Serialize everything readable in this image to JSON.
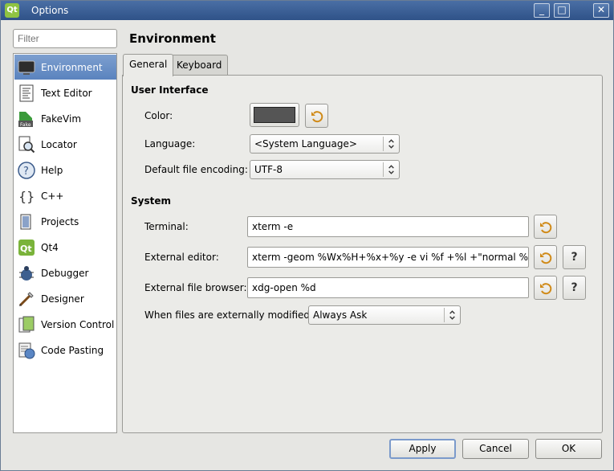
{
  "window": {
    "title": "Options",
    "app_icon_text": "Qt",
    "minimize_glyph": "_",
    "maximize_glyph": "□",
    "close_glyph": "✕"
  },
  "filter": {
    "placeholder": "Filter"
  },
  "sidebar": {
    "items": [
      {
        "label": "Environment",
        "icon": "monitor-icon",
        "selected": true
      },
      {
        "label": "Text Editor",
        "icon": "text-editor-icon"
      },
      {
        "label": "FakeVim",
        "icon": "fakevim-icon"
      },
      {
        "label": "Locator",
        "icon": "locator-icon"
      },
      {
        "label": "Help",
        "icon": "help-icon"
      },
      {
        "label": "C++",
        "icon": "cpp-icon"
      },
      {
        "label": "Projects",
        "icon": "projects-icon"
      },
      {
        "label": "Qt4",
        "icon": "qt4-icon"
      },
      {
        "label": "Debugger",
        "icon": "debugger-icon"
      },
      {
        "label": "Designer",
        "icon": "designer-icon"
      },
      {
        "label": "Version Control",
        "icon": "version-control-icon"
      },
      {
        "label": "Code Pasting",
        "icon": "code-pasting-icon"
      }
    ]
  },
  "page": {
    "title": "Environment"
  },
  "tabs": [
    {
      "label": "General",
      "active": true
    },
    {
      "label": "Keyboard",
      "active": false
    }
  ],
  "user_interface": {
    "heading": "User Interface",
    "color_label": "Color:",
    "color_value": "#555555",
    "language_label": "Language:",
    "language_value": "<System Language>",
    "encoding_label": "Default file encoding:",
    "encoding_value": "UTF-8"
  },
  "system": {
    "heading": "System",
    "terminal_label": "Terminal:",
    "terminal_value": "xterm -e",
    "editor_label": "External editor:",
    "editor_value": "xterm -geom %Wx%H+%x+%y -e vi %f +%l +\"normal %c|\"",
    "browser_label": "External file browser:",
    "browser_value": "xdg-open %d",
    "modified_label": "When files are externally modified:",
    "modified_value": "Always Ask",
    "help_glyph": "?"
  },
  "buttons": {
    "apply": "Apply",
    "cancel": "Cancel",
    "ok": "OK"
  }
}
